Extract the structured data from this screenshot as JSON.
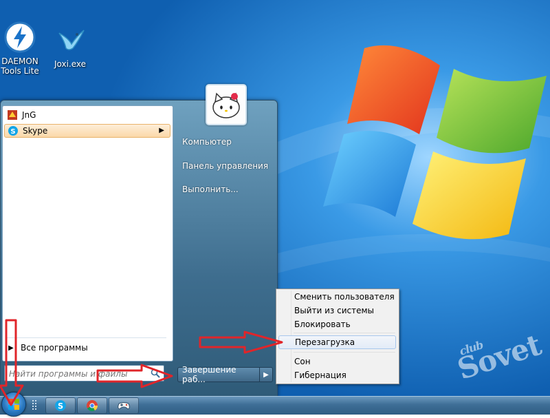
{
  "desktop": {
    "icons": [
      {
        "label_line1": "DAEMON",
        "label_line2": "Tools Lite",
        "icon": "daemon-tools-icon"
      },
      {
        "label_line1": "Joxi.exe",
        "icon": "joxi-bird-icon"
      }
    ],
    "watermark": {
      "top": "club",
      "main": "Sovet"
    }
  },
  "start_menu": {
    "pinned_programs": [
      {
        "label": "JnG",
        "icon": "jng-icon"
      },
      {
        "label": "Skype",
        "icon": "skype-icon",
        "has_submenu": true
      }
    ],
    "all_programs_label": "Все программы",
    "search": {
      "placeholder": "Найти программы и файлы"
    },
    "right_items": [
      {
        "label": "Компьютер"
      },
      {
        "label": "Панель управления"
      },
      {
        "label": "Выполнить..."
      }
    ],
    "shutdown_label": "Завершение раб...",
    "user_picture": "hello-kitty-avatar"
  },
  "shutdown_menu": {
    "items": [
      {
        "label": "Сменить пользователя"
      },
      {
        "label": "Выйти из системы"
      },
      {
        "label": "Блокировать"
      },
      {
        "label": "Перезагрузка",
        "highlighted": true
      },
      {
        "label": "Сон"
      },
      {
        "label": "Гибернация"
      }
    ]
  },
  "taskbar": {
    "buttons": [
      {
        "icon": "skype-icon"
      },
      {
        "icon": "chrome-icon"
      },
      {
        "icon": "gamepad-icon"
      }
    ]
  },
  "colors": {
    "desktop_bg": "#1d7ed0",
    "annotation_red": "#e0252a",
    "highlight": "#fbd8a8"
  }
}
